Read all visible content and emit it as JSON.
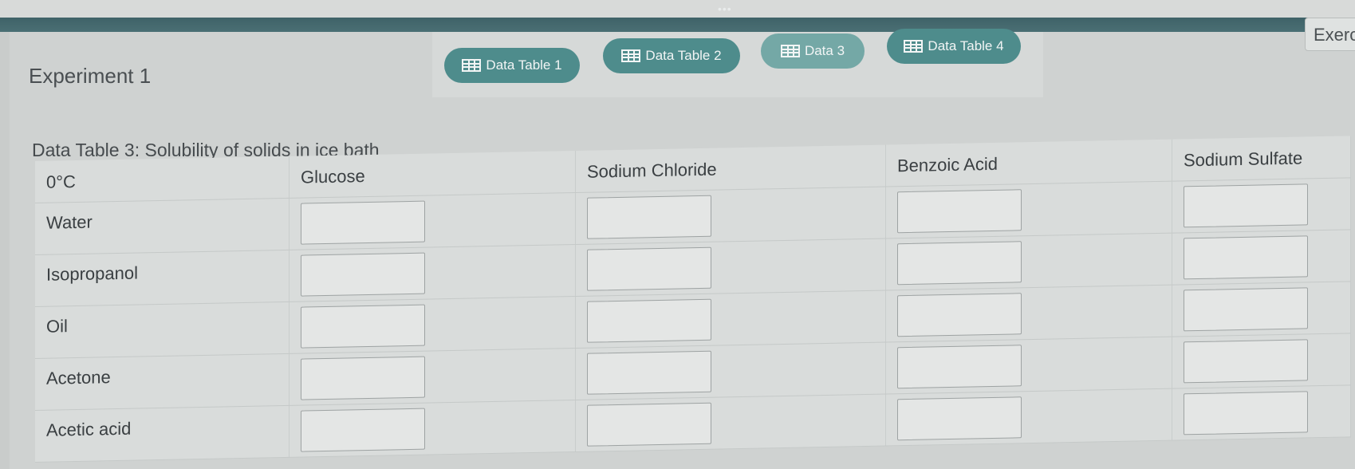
{
  "header": {
    "menu_dots": "•••"
  },
  "experiment": {
    "title": "Experiment 1"
  },
  "tabs": [
    {
      "label": "Data Table 1",
      "icon": "table-icon"
    },
    {
      "label": "Data Table 2",
      "icon": "table-icon"
    },
    {
      "label": "Data 3",
      "icon": "table-icon"
    },
    {
      "label": "Data Table 4",
      "icon": "table-icon"
    }
  ],
  "exercise_button": {
    "label": "Exerc"
  },
  "table": {
    "caption": "Data Table 3: Solubility of solids in ice bath",
    "corner_header": "0°C",
    "columns": [
      "Glucose",
      "Sodium Chloride",
      "Benzoic Acid",
      "Sodium Sulfate"
    ],
    "rows": [
      "Water",
      "Isopropanol",
      "Oil",
      "Acetone",
      "Acetic acid"
    ]
  },
  "colors": {
    "tab_accent": "#4e8c8c",
    "topbar": "#3f6268"
  }
}
